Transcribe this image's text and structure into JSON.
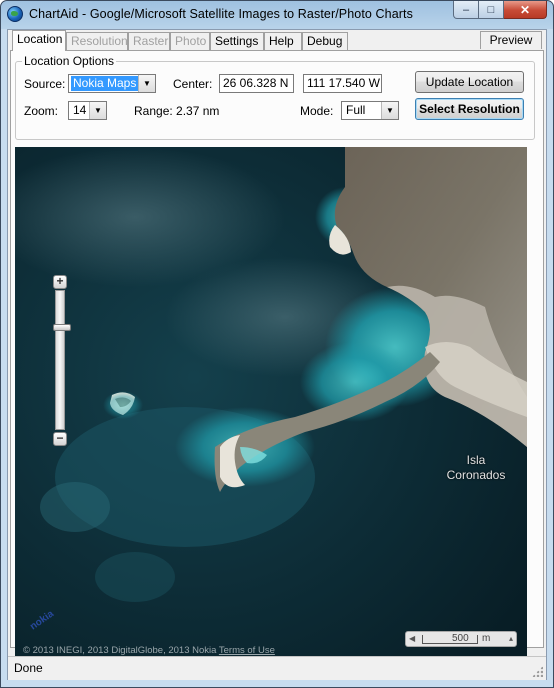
{
  "window": {
    "title": "ChartAid - Google/Microsoft Satellite Images to Raster/Photo Charts",
    "controls": {
      "minimize": "–",
      "maximize": "□",
      "close": "✕"
    }
  },
  "tabs": [
    {
      "label": "Location",
      "state": "active"
    },
    {
      "label": "Resolution",
      "state": "disabled"
    },
    {
      "label": "Raster",
      "state": "disabled"
    },
    {
      "label": "Photo",
      "state": "disabled"
    },
    {
      "label": "Settings",
      "state": "enabled"
    },
    {
      "label": "Help",
      "state": "enabled"
    },
    {
      "label": "Debug",
      "state": "enabled"
    }
  ],
  "preview_tab": "Preview",
  "location_options": {
    "legend": "Location Options",
    "source_label": "Source:",
    "source_value": "Nokia Maps",
    "center_label": "Center:",
    "lat_value": "26 06.328 N",
    "lon_value": "111 17.540 W",
    "update_button": "Update Location",
    "zoom_label": "Zoom:",
    "zoom_value": "14",
    "range_text": "Range: 2.37 nm",
    "mode_label": "Mode:",
    "mode_value": "Full",
    "select_button": "Select Resolution"
  },
  "map": {
    "island_label_line1": "Isla",
    "island_label_line2": "Coronados",
    "copyright": "© 2013 INEGI, 2013 DigitalGlobe, 2013 Nokia",
    "terms_link": "Terms of Use",
    "logo": "nokia",
    "scale_value": "500",
    "scale_unit": "m",
    "zoom_in": "+",
    "zoom_out": "−",
    "colors": {
      "deep_water": "#0b2630",
      "shallow_water": "#2ab8c0",
      "land": "#6e6a60",
      "sand": "#e6e2d8"
    }
  },
  "status": {
    "text": "Done"
  }
}
